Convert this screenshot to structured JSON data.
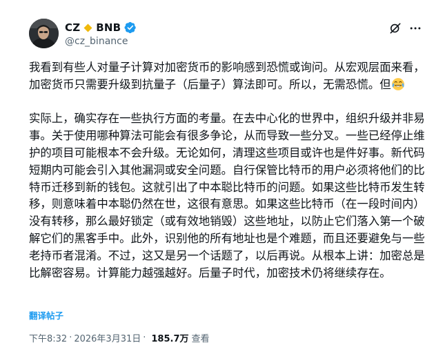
{
  "author": {
    "name_part1": "CZ",
    "name_part2": "BNB",
    "handle": "@cz_binance",
    "brand_color": "#f0b90b",
    "verified_color": "#1d9bf0",
    "icons": [
      "bnb-diamond-icon",
      "verified-badge-icon"
    ]
  },
  "header_actions": {
    "icons": [
      "grok-icon",
      "more-icon"
    ]
  },
  "tweet": {
    "paragraph1": "我看到有些人对量子计算对加密货币的影响感到恐慌或询问。从宏观层面来看，加密货币只需要升级到抗量子（后量子）算法即可。所以，无需恐慌。但",
    "paragraph1_emoji": "face-with-tears-of-joy-icon",
    "paragraph2": "实际上，确实存在一些执行方面的考量。在去中心化的世界中，组织升级并非易事。关于使用哪种算法可能会有很多争论，从而导致一些分叉。一些已经停止维护的项目可能根本不会升级。无论如何，清理这些项目或许也是件好事。新代码短期内可能会引入其他漏洞或安全问题。自行保管比特币的用户必须将他们的比特币迁移到新的钱包。这就引出了中本聪比特币的问题。如果这些比特币发生转移，则意味着中本聪仍然在世，这很有意思。如果这些比特币（在一段时间内）没有转移，那么最好锁定（或有效地销毁）这些地址，以防止它们落入第一个破解它们的黑客手中。此外，识别他的所有地址也是个难题，而且还要避免与一些老持币者混淆。不过，这又是另一个话题了，以后再说。从根本上讲：加密总是比解密容易。计算能力越强越好。后量子时代，加密技术仍将继续存在。",
    "translate_label": "翻译帖子"
  },
  "meta": {
    "time": "下午8:32",
    "separator": "·",
    "date": "2026年3月31日",
    "views_count": "185.7万",
    "views_label": "查看"
  }
}
